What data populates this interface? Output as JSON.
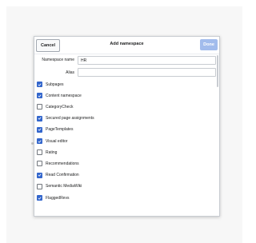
{
  "dialog": {
    "title": "Add namespace",
    "cancel_label": "Cancel",
    "done_label": "Done"
  },
  "fields": {
    "namespace_name_label": "Namespace name",
    "namespace_name_value": "HR",
    "alias_label": "Alias",
    "alias_value": ""
  },
  "options": [
    {
      "label": "Subpages",
      "checked": true
    },
    {
      "label": "Content namespace",
      "checked": true
    },
    {
      "label": "CategoryCheck",
      "checked": false
    },
    {
      "label": "Secured page assignments",
      "checked": true
    },
    {
      "label": "PageTemplates",
      "checked": true
    },
    {
      "label": "Visual editor",
      "checked": true
    },
    {
      "label": "Rating",
      "checked": false
    },
    {
      "label": "Recommendations",
      "checked": false
    },
    {
      "label": "Read Confirmation",
      "checked": true
    },
    {
      "label": "Semantic MediaWiki",
      "checked": false
    },
    {
      "label": "FlaggedRevs",
      "checked": true
    }
  ],
  "colors": {
    "accent": "#3366cc",
    "done_disabled": "#a2bcec"
  }
}
